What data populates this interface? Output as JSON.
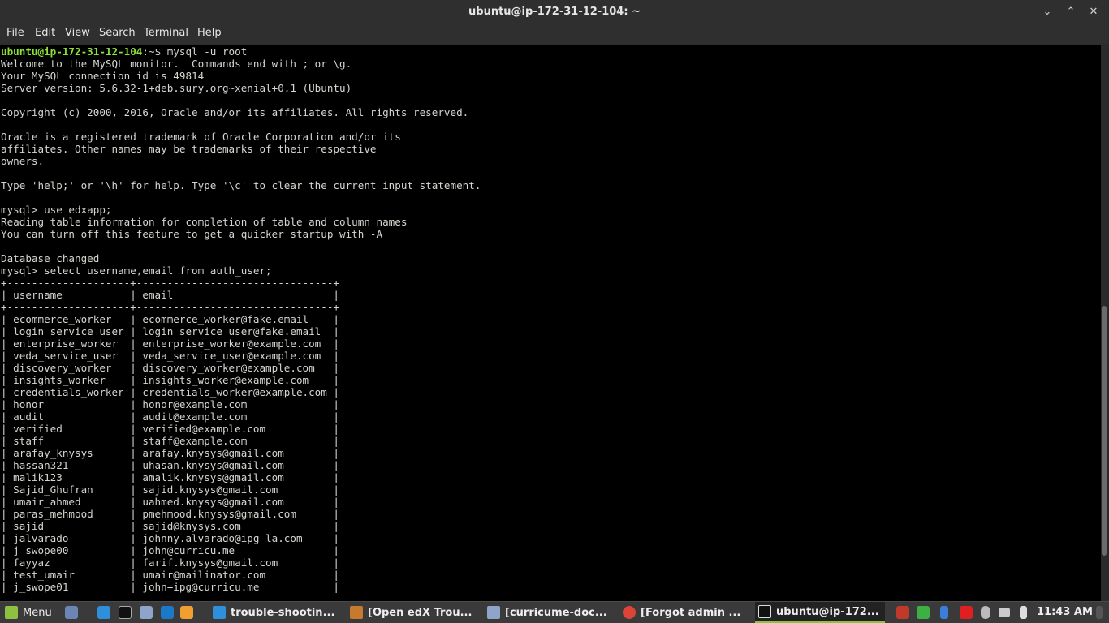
{
  "window": {
    "title": "ubuntu@ip-172-31-12-104: ~",
    "controls": {
      "minimize": "⌄",
      "maximize": "⌃",
      "close": "✕"
    }
  },
  "menu": [
    "File",
    "Edit",
    "Search",
    "View",
    "Terminal",
    "Help"
  ],
  "menu_order": {
    "file": "File",
    "edit": "Edit",
    "view": "View",
    "search": "Search",
    "terminal": "Terminal",
    "help": "Help"
  },
  "terminal": {
    "prompt_user": "ubuntu@ip-172-31-12-104",
    "prompt_rest": ":~$ mysql -u root",
    "output": "Welcome to the MySQL monitor.  Commands end with ; or \\g.\nYour MySQL connection id is 49814\nServer version: 5.6.32-1+deb.sury.org~xenial+0.1 (Ubuntu)\n\nCopyright (c) 2000, 2016, Oracle and/or its affiliates. All rights reserved.\n\nOracle is a registered trademark of Oracle Corporation and/or its\naffiliates. Other names may be trademarks of their respective\nowners.\n\nType 'help;' or '\\h' for help. Type '\\c' to clear the current input statement.\n\nmysql> use edxapp;\nReading table information for completion of table and column names\nYou can turn off this feature to get a quicker startup with -A\n\nDatabase changed\nmysql> select username,email from auth_user;\n+--------------------+--------------------------------+\n| username           | email                          |\n+--------------------+--------------------------------+\n| ecommerce_worker   | ecommerce_worker@fake.email    |\n| login_service_user | login_service_user@fake.email  |\n| enterprise_worker  | enterprise_worker@example.com  |\n| veda_service_user  | veda_service_user@example.com  |\n| discovery_worker   | discovery_worker@example.com   |\n| insights_worker    | insights_worker@example.com    |\n| credentials_worker | credentials_worker@example.com |\n| honor              | honor@example.com              |\n| audit              | audit@example.com              |\n| verified           | verified@example.com           |\n| staff              | staff@example.com              |\n| arafay_knysys      | arafay.knysys@gmail.com        |\n| hassan321          | uhasan.knysys@gmail.com        |\n| malik123           | amalik.knysys@gmail.com        |\n| Sajid_Ghufran      | sajid.knysys@gmail.com         |\n| umair_ahmed        | uahmed.knysys@gmail.com        |\n| paras_mehmood      | pmehmood.knysys@gmail.com      |\n| sajid              | sajid@knysys.com               |\n| jalvarado          | johnny.alvarado@ipg-la.com     |\n| j_swope00          | john@curricu.me                |\n| fayyaz             | farif.knysys@gmail.com         |\n| test_umair         | umair@mailinator.com           |\n| j_swope01          | john+ipg@curricu.me            |"
  },
  "taskbar": {
    "menu_label": "Menu",
    "tasks": [
      {
        "label": "trouble-shootin...",
        "icon": "vscode-icon",
        "color": "#2f8fdb"
      },
      {
        "label": "[Open edX Trou...",
        "icon": "image-viewer-icon",
        "color": "#c77a2d"
      },
      {
        "label": "[curricume-doc...",
        "icon": "folder-icon",
        "color": "#8fa4c9"
      },
      {
        "label": "[Forgot admin ...",
        "icon": "chrome-icon",
        "color": "#db4437"
      },
      {
        "label": "ubuntu@ip-172...",
        "icon": "terminal-icon",
        "color": "#dddddd"
      }
    ],
    "clock": "11:43 AM",
    "colors": {
      "mint_green": "#8ec13f",
      "prompt_green": "#8ae234"
    }
  }
}
